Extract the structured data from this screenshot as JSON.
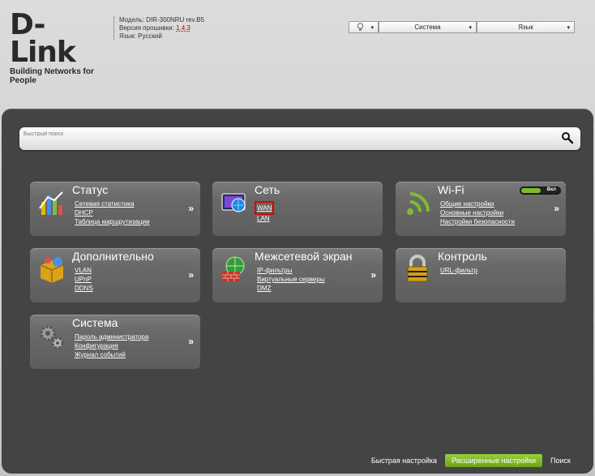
{
  "header": {
    "logo": "D-Link",
    "tagline": "Building Networks for People",
    "model_label": "Модель:",
    "model": "DIR-300NRU rev.B5",
    "firmware_label": "Версия прошивки:",
    "firmware": "1.4.3",
    "language_label": "Язык:",
    "language": "Русский"
  },
  "topbar": {
    "bulb_icon": "lightbulb-icon",
    "system_label": "Система",
    "language_label": "Язык",
    "dropdown_arrow": "▾"
  },
  "search": {
    "placeholder": "Быстрый поиск"
  },
  "tiles": [
    {
      "title": "Статус",
      "icon": "status-chart-icon",
      "links": [
        "Сетевая статистика",
        "DHCP",
        "Таблица маршрутизации"
      ]
    },
    {
      "title": "Сеть",
      "icon": "network-monitor-icon",
      "links": [
        "WAN",
        "LAN"
      ]
    },
    {
      "title": "Wi-Fi",
      "icon": "wifi-icon",
      "links": [
        "Общие настройки",
        "Основные настройки",
        "Настройки безопасности"
      ],
      "toggle_label": "Вкл"
    },
    {
      "title": "Дополнительно",
      "icon": "box-icon",
      "links": [
        "VLAN",
        "UPnP",
        "DDNS"
      ]
    },
    {
      "title": "Межсетевой экран",
      "icon": "firewall-globe-icon",
      "links": [
        "IP-фильтры",
        "Виртуальные серверы",
        "DMZ"
      ]
    },
    {
      "title": "Контроль",
      "icon": "padlock-icon",
      "links": [
        "URL-фильтр"
      ]
    },
    {
      "title": "Система",
      "icon": "gears-icon",
      "links": [
        "Пароль администратора",
        "Конфигурация",
        "Журнал событий"
      ]
    }
  ],
  "chevron": "»",
  "bottom_nav": {
    "quick": "Быстрая настройка",
    "advanced": "Расширенные настройки",
    "search": "Поиск"
  },
  "colors": {
    "panel": "#444444",
    "accent_green": "#7dbd2d",
    "highlight": "#e00000"
  }
}
